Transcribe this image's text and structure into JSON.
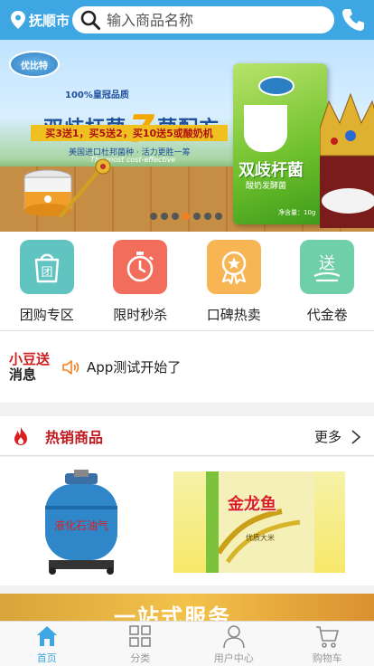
{
  "header": {
    "city": "抚顺市",
    "search_placeholder": "输入商品名称"
  },
  "banner": {
    "brand_logo": "优比特",
    "subtitle": "100%皇冠品质",
    "title_left": "双歧杆菌",
    "title_number": "7",
    "title_right": "菌配方",
    "promo": "买3送1，买5送2，买10送5或酸奶机",
    "note": "美国进口杜邦菌种 · 活力更胜一筹",
    "english": "The most cost-effective",
    "pack_name": "双歧杆菌",
    "pack_sub": "酸奶发酵菌",
    "pack_foot": "净含量：10g",
    "active_slide": 4,
    "slide_count": 7
  },
  "categories": [
    {
      "label": "团购专区",
      "icon": "group-buy-bag-icon",
      "color": "#62c4c0"
    },
    {
      "label": "限时秒杀",
      "icon": "stopwatch-icon",
      "color": "#f26d5b"
    },
    {
      "label": "口碑热卖",
      "icon": "medal-star-icon",
      "color": "#f8b553"
    },
    {
      "label": "代金卷",
      "icon": "voucher-gift-icon",
      "color": "#6fcfa8"
    }
  ],
  "news": {
    "logo_line1": "小豆送",
    "logo_line2": "消息",
    "text": "App测试开始了"
  },
  "hot": {
    "title": "热销商品",
    "more": "更多",
    "products": [
      {
        "name": "液化石油气",
        "icon": "lpg-gas-cylinder"
      },
      {
        "name": "金龙鱼",
        "icon": "rice-bag",
        "sub": "优质大米"
      }
    ]
  },
  "ad": {
    "text": "一站式服务"
  },
  "tabbar": [
    {
      "label": "首页",
      "icon": "home-icon",
      "active": true
    },
    {
      "label": "分类",
      "icon": "category-grid-icon",
      "active": false
    },
    {
      "label": "用户中心",
      "icon": "user-icon",
      "active": false
    },
    {
      "label": "购物车",
      "icon": "cart-icon",
      "active": false
    }
  ],
  "colors": {
    "primary": "#3ea7e3",
    "hot_red": "#c0191e"
  }
}
